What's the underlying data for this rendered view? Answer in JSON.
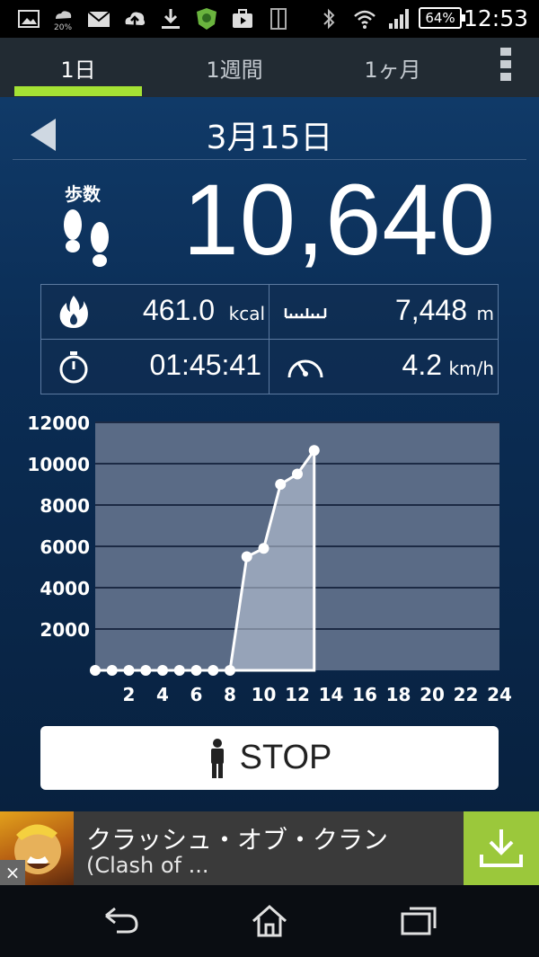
{
  "status_bar": {
    "time": "12:53",
    "battery": "64%",
    "weather_text": "20%",
    "icons": [
      "image-icon",
      "weather-icon",
      "mail-icon",
      "cloud-upload-icon",
      "download-icon",
      "shield-app-icon",
      "briefcase-icon",
      "phone-outline-icon",
      "bluetooth-icon",
      "wifi-icon",
      "signal-icon",
      "battery-icon"
    ]
  },
  "tabs": [
    {
      "label": "1日",
      "active": true
    },
    {
      "label": "1週間",
      "active": false
    },
    {
      "label": "1ヶ月",
      "active": false
    }
  ],
  "date": "3月15日",
  "steps": {
    "label": "歩数",
    "value": "10,640"
  },
  "stats": {
    "calories": {
      "value": "461.0",
      "unit": "kcal"
    },
    "distance": {
      "value": "7,448",
      "unit": "m"
    },
    "time": {
      "value": "01:45:41"
    },
    "speed": {
      "value": "4.2",
      "unit": "km/h"
    }
  },
  "stop_button": {
    "label": "STOP"
  },
  "ad": {
    "title": "クラッシュ・オブ・クラン",
    "subtitle": "(Clash of ...",
    "close": "×"
  },
  "colors": {
    "accent": "#a4e234",
    "chart_bg": "#5a6b86",
    "background": "#0b2d55",
    "ad_download": "#9bc83b"
  },
  "chart_data": {
    "type": "area",
    "x": [
      0,
      1,
      2,
      3,
      4,
      5,
      6,
      7,
      8,
      9,
      10,
      11,
      12,
      13
    ],
    "values": [
      0,
      0,
      0,
      0,
      0,
      0,
      0,
      0,
      0,
      5500,
      5900,
      9000,
      9500,
      10640
    ],
    "x_ticks": [
      "2",
      "4",
      "6",
      "8",
      "10",
      "12",
      "14",
      "16",
      "18",
      "20",
      "22",
      "24"
    ],
    "x_tick_values": [
      2,
      4,
      6,
      8,
      10,
      12,
      14,
      16,
      18,
      20,
      22,
      24
    ],
    "y_ticks": [
      "2000",
      "4000",
      "6000",
      "8000",
      "10000",
      "12000"
    ],
    "y_tick_values": [
      2000,
      4000,
      6000,
      8000,
      10000,
      12000
    ],
    "xlim": [
      0,
      24
    ],
    "ylim": [
      0,
      12000
    ],
    "grid": true
  }
}
